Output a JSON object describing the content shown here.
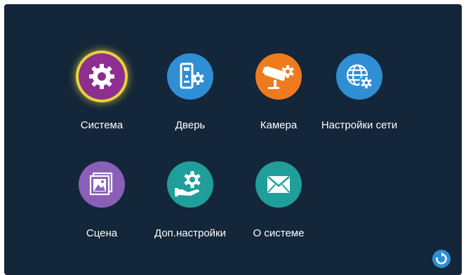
{
  "menu": {
    "items": [
      {
        "label": "Система",
        "icon": "gear-icon",
        "color": "#8e2f8f",
        "selected": true
      },
      {
        "label": "Дверь",
        "icon": "door-settings-icon",
        "color": "#2f8ed4",
        "selected": false
      },
      {
        "label": "Камера",
        "icon": "camera-settings-icon",
        "color": "#f07a1e",
        "selected": false
      },
      {
        "label": "Настройки сети",
        "icon": "network-settings-icon",
        "color": "#2f8ed4",
        "selected": false
      },
      {
        "label": "Сцена",
        "icon": "scene-icon",
        "color": "#8a5fb8",
        "selected": false
      },
      {
        "label": "Доп.настройки",
        "icon": "extra-settings-icon",
        "color": "#1f9e9a",
        "selected": false
      },
      {
        "label": "О системе",
        "icon": "mail-icon",
        "color": "#1f9e9a",
        "selected": false
      }
    ]
  },
  "footer": {
    "refresh_icon": "refresh-icon",
    "refresh_color": "#2f8ed4"
  },
  "colors": {
    "background": "#14263a",
    "selection_ring": "#e6d33a",
    "text": "#ffffff"
  }
}
